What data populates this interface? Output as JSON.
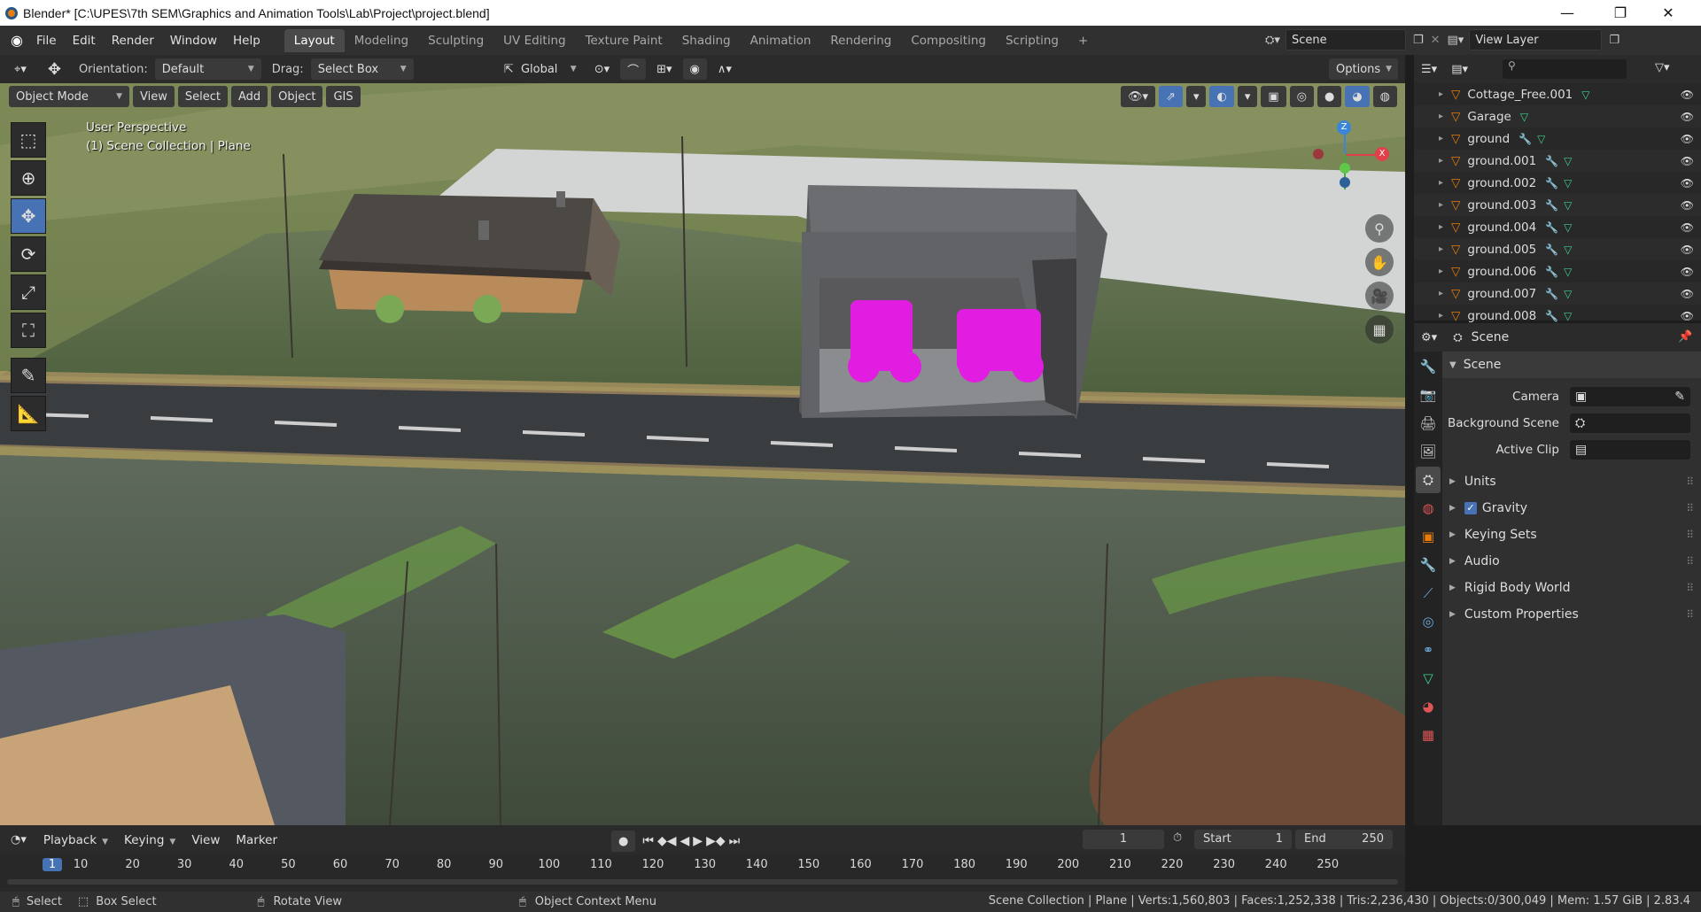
{
  "window": {
    "title": "Blender* [C:\\UPES\\7th SEM\\Graphics and Animation Tools\\Lab\\Project\\project.blend]",
    "controls": [
      "—",
      "❐",
      "✕"
    ]
  },
  "menu": {
    "items": [
      "File",
      "Edit",
      "Render",
      "Window",
      "Help"
    ],
    "workspaces": [
      "Layout",
      "Modeling",
      "Sculpting",
      "UV Editing",
      "Texture Paint",
      "Shading",
      "Animation",
      "Rendering",
      "Compositing",
      "Scripting"
    ],
    "active_workspace": "Layout",
    "add_tab": "+",
    "scene_label": "Scene",
    "view_layer_label": "View Layer"
  },
  "viewport_header": {
    "orientation_label": "Orientation:",
    "orientation_value": "Default",
    "drag_label": "Drag:",
    "drag_value": "Select Box",
    "transform_value": "Global",
    "options_label": "Options",
    "mode": "Object Mode",
    "menus": [
      "View",
      "Select",
      "Add",
      "Object",
      "GIS"
    ]
  },
  "viewport": {
    "perspective": "User Perspective",
    "collection": "(1) Scene Collection | Plane",
    "gizmo_axes": [
      "Z",
      "X",
      "Y"
    ]
  },
  "outliner": {
    "rows": [
      {
        "name": "Cottage_Free.001",
        "icons": [
          "mesh"
        ]
      },
      {
        "name": "Garage",
        "icons": [
          "mesh"
        ]
      },
      {
        "name": "ground",
        "icons": [
          "wrench",
          "mesh"
        ]
      },
      {
        "name": "ground.001",
        "icons": [
          "wrench",
          "mesh"
        ]
      },
      {
        "name": "ground.002",
        "icons": [
          "wrench",
          "mesh"
        ]
      },
      {
        "name": "ground.003",
        "icons": [
          "wrench",
          "mesh"
        ]
      },
      {
        "name": "ground.004",
        "icons": [
          "wrench",
          "mesh"
        ]
      },
      {
        "name": "ground.005",
        "icons": [
          "wrench",
          "mesh"
        ]
      },
      {
        "name": "ground.006",
        "icons": [
          "wrench",
          "mesh"
        ]
      },
      {
        "name": "ground.007",
        "icons": [
          "wrench",
          "mesh"
        ]
      },
      {
        "name": "ground.008",
        "icons": [
          "wrench",
          "mesh"
        ]
      }
    ]
  },
  "properties": {
    "context_label": "Scene",
    "panel_title": "Scene",
    "fields": [
      {
        "label": "Camera"
      },
      {
        "label": "Background Scene"
      },
      {
        "label": "Active Clip"
      }
    ],
    "subpanels": [
      "Units",
      "Gravity",
      "Keying Sets",
      "Audio",
      "Rigid Body World",
      "Custom Properties"
    ],
    "gravity_checked": true
  },
  "timeline": {
    "menus": [
      "Playback",
      "Keying",
      "View",
      "Marker"
    ],
    "current_frame": "1",
    "start_label": "Start",
    "start_value": "1",
    "end_label": "End",
    "end_value": "250",
    "ruler": [
      "1",
      "10",
      "20",
      "30",
      "40",
      "50",
      "60",
      "70",
      "80",
      "90",
      "100",
      "110",
      "120",
      "130",
      "140",
      "150",
      "160",
      "170",
      "180",
      "190",
      "200",
      "210",
      "220",
      "230",
      "240",
      "250"
    ]
  },
  "statusbar": {
    "select": "Select",
    "box_select": "Box Select",
    "rotate_view": "Rotate View",
    "context_menu": "Object Context Menu",
    "stats": "Scene Collection | Plane | Verts:1,560,803 | Faces:1,252,338 | Tris:2,236,430 | Objects:0/300,049 | Mem: 1.57 GiB | 2.83.4"
  },
  "colors": {
    "accent": "#4772b3",
    "object_orange": "#e87d0d",
    "mesh_green": "#3fd18e",
    "wrench_blue": "#6fa8dc",
    "tractor_magenta": "#e11de1"
  }
}
